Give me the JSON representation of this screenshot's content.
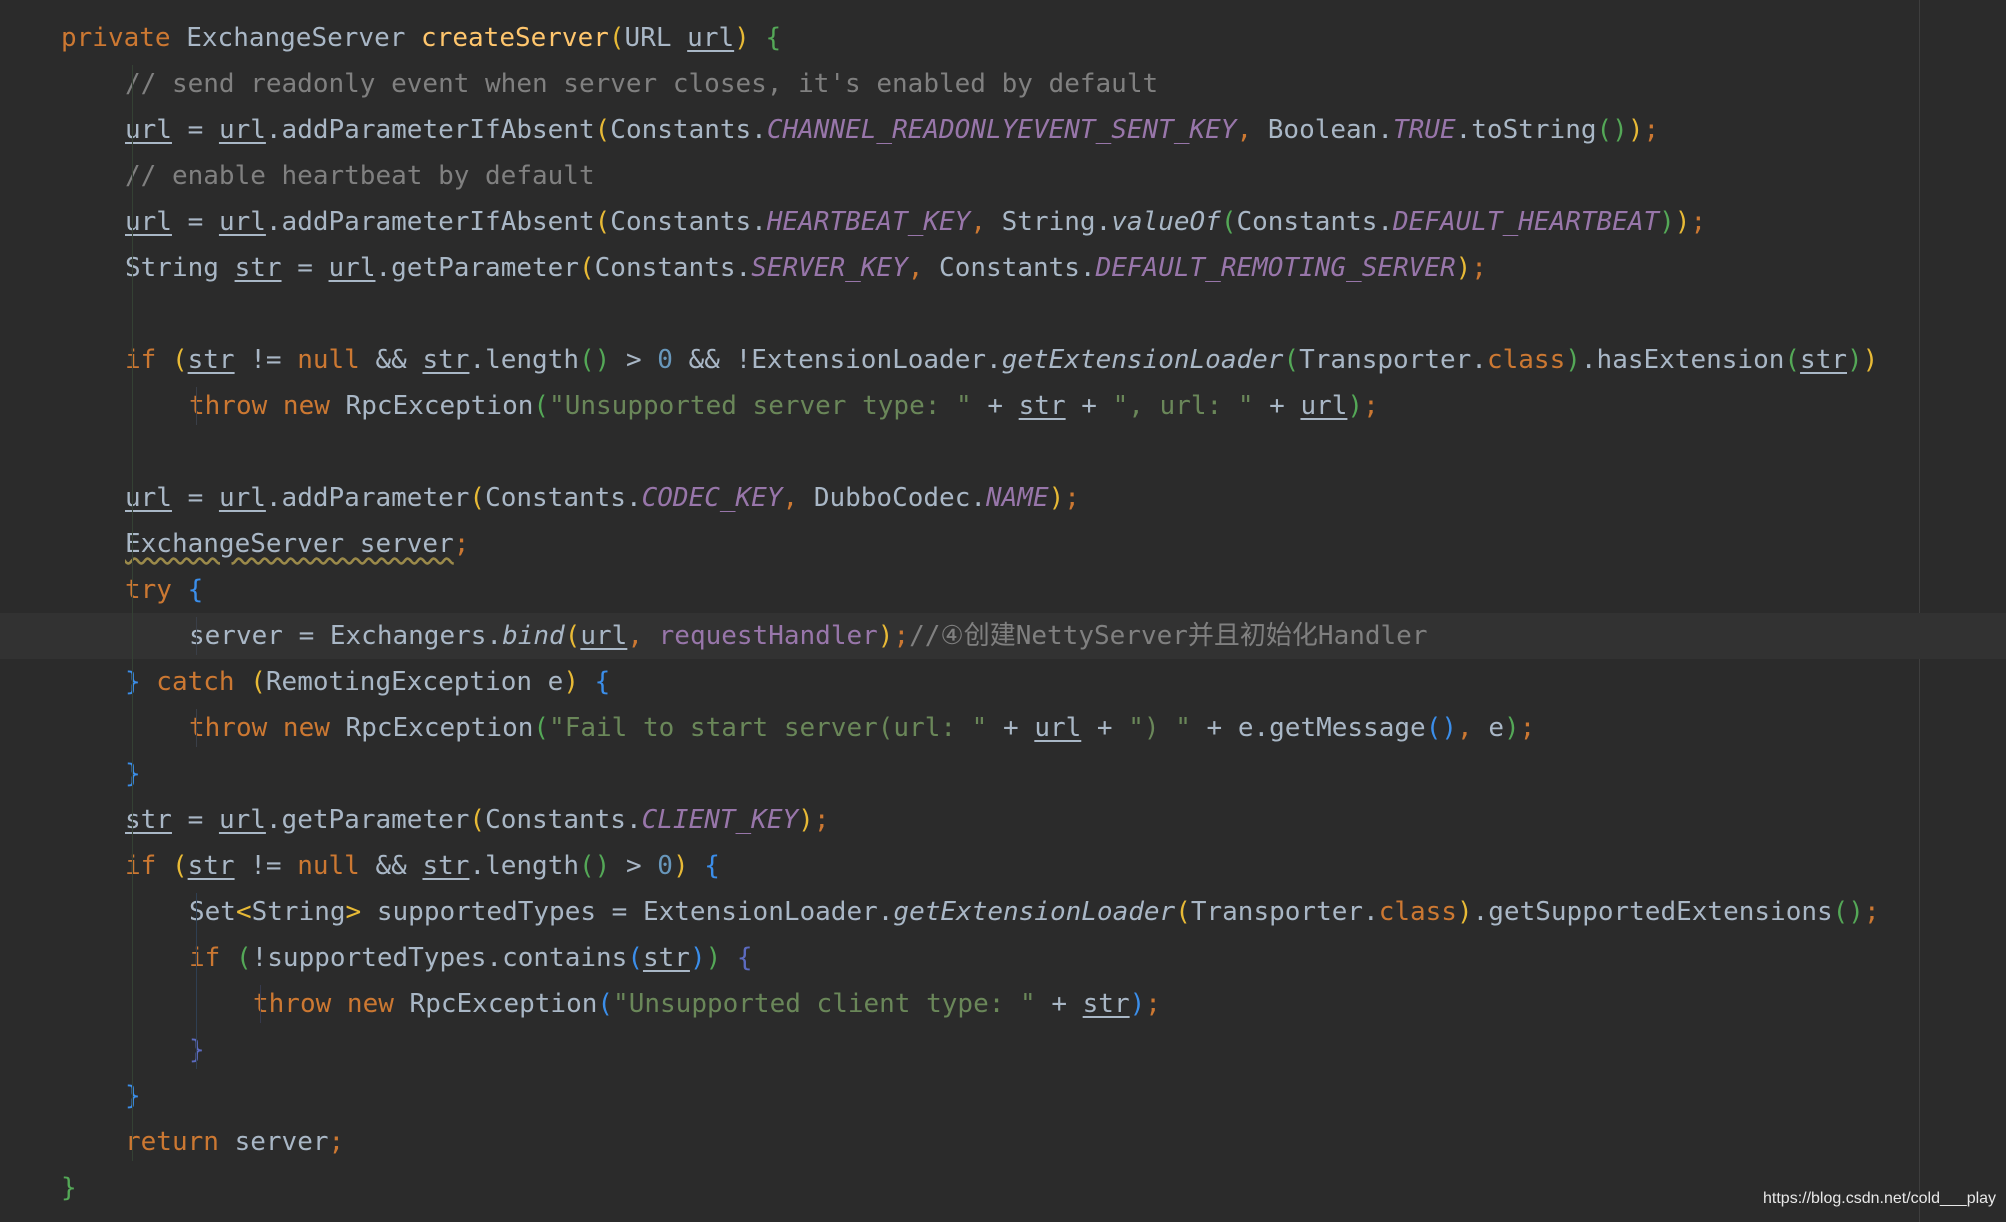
{
  "code": {
    "lines": [
      {
        "indent": 0,
        "tokens": [
          [
            "private ",
            "k"
          ],
          [
            "ExchangeServer ",
            "t"
          ],
          [
            "createServer",
            "m"
          ],
          [
            "(",
            "y"
          ],
          [
            "URL ",
            "t"
          ],
          [
            "url",
            "u"
          ],
          [
            ")",
            "y"
          ],
          [
            " ",
            "t"
          ],
          [
            "{",
            "g"
          ]
        ]
      },
      {
        "indent": 1,
        "tokens": [
          [
            "// send readonly event when server closes, it's enabled by default",
            "cm"
          ]
        ]
      },
      {
        "indent": 1,
        "tokens": [
          [
            "url",
            "u"
          ],
          [
            " = ",
            "t"
          ],
          [
            "url",
            "u"
          ],
          [
            ".addParameterIfAbsent",
            "t"
          ],
          [
            "(",
            "y"
          ],
          [
            "Constants.",
            "t"
          ],
          [
            "CHANNEL_READONLYEVENT_SENT_KEY",
            "c"
          ],
          [
            ", ",
            "k"
          ],
          [
            "Boolean.",
            "t"
          ],
          [
            "TRUE",
            "c"
          ],
          [
            ".toString",
            "t"
          ],
          [
            "()",
            "g"
          ],
          [
            ")",
            "y"
          ],
          [
            ";",
            "k"
          ]
        ]
      },
      {
        "indent": 1,
        "tokens": [
          [
            "// enable heartbeat by default",
            "cm"
          ]
        ]
      },
      {
        "indent": 1,
        "tokens": [
          [
            "url",
            "u"
          ],
          [
            " = ",
            "t"
          ],
          [
            "url",
            "u"
          ],
          [
            ".addParameterIfAbsent",
            "t"
          ],
          [
            "(",
            "y"
          ],
          [
            "Constants.",
            "t"
          ],
          [
            "HEARTBEAT_KEY",
            "c"
          ],
          [
            ", ",
            "k"
          ],
          [
            "String.",
            "t"
          ],
          [
            "valueOf",
            "i"
          ],
          [
            "(",
            "g"
          ],
          [
            "Constants.",
            "t"
          ],
          [
            "DEFAULT_HEARTBEAT",
            "c"
          ],
          [
            ")",
            "g"
          ],
          [
            ")",
            "y"
          ],
          [
            ";",
            "k"
          ]
        ]
      },
      {
        "indent": 1,
        "tokens": [
          [
            "String ",
            "t"
          ],
          [
            "str",
            "u"
          ],
          [
            " = ",
            "t"
          ],
          [
            "url",
            "u"
          ],
          [
            ".getParameter",
            "t"
          ],
          [
            "(",
            "y"
          ],
          [
            "Constants.",
            "t"
          ],
          [
            "SERVER_KEY",
            "c"
          ],
          [
            ", ",
            "k"
          ],
          [
            "Constants.",
            "t"
          ],
          [
            "DEFAULT_REMOTING_SERVER",
            "c"
          ],
          [
            ")",
            "y"
          ],
          [
            ";",
            "k"
          ]
        ]
      },
      {
        "indent": 0,
        "tokens": []
      },
      {
        "indent": 1,
        "tokens": [
          [
            "if ",
            "k"
          ],
          [
            "(",
            "y"
          ],
          [
            "str",
            "u"
          ],
          [
            " != ",
            "t"
          ],
          [
            "null",
            "k"
          ],
          [
            " && ",
            "t"
          ],
          [
            "str",
            "u"
          ],
          [
            ".length",
            "t"
          ],
          [
            "()",
            "g"
          ],
          [
            " > ",
            "t"
          ],
          [
            "0",
            "n"
          ],
          [
            " && !ExtensionLoader.",
            "t"
          ],
          [
            "getExtensionLoader",
            "i"
          ],
          [
            "(",
            "g"
          ],
          [
            "Transporter.",
            "t"
          ],
          [
            "class",
            "k"
          ],
          [
            ")",
            "g"
          ],
          [
            ".hasExtension",
            "t"
          ],
          [
            "(",
            "g"
          ],
          [
            "str",
            "u"
          ],
          [
            ")",
            "g"
          ],
          [
            ")",
            "y"
          ]
        ]
      },
      {
        "indent": 2,
        "tokens": [
          [
            "throw new ",
            "k"
          ],
          [
            "RpcException",
            "t"
          ],
          [
            "(",
            "g"
          ],
          [
            "\"Unsupported server type: \"",
            "s"
          ],
          [
            " + ",
            "t"
          ],
          [
            "str",
            "u"
          ],
          [
            " + ",
            "t"
          ],
          [
            "\", url: \"",
            "s"
          ],
          [
            " + ",
            "t"
          ],
          [
            "url",
            "u"
          ],
          [
            ")",
            "g"
          ],
          [
            ";",
            "k"
          ]
        ]
      },
      {
        "indent": 0,
        "tokens": []
      },
      {
        "indent": 1,
        "tokens": [
          [
            "url",
            "u"
          ],
          [
            " = ",
            "t"
          ],
          [
            "url",
            "u"
          ],
          [
            ".addParameter",
            "t"
          ],
          [
            "(",
            "y"
          ],
          [
            "Constants.",
            "t"
          ],
          [
            "CODEC_KEY",
            "c"
          ],
          [
            ", ",
            "k"
          ],
          [
            "DubboCodec.",
            "t"
          ],
          [
            "NAME",
            "c"
          ],
          [
            ")",
            "y"
          ],
          [
            ";",
            "k"
          ]
        ]
      },
      {
        "indent": 1,
        "tokens": [
          [
            "ExchangeServer server",
            "w"
          ],
          [
            ";",
            "k"
          ]
        ]
      },
      {
        "indent": 1,
        "tokens": [
          [
            "try ",
            "k"
          ],
          [
            "{",
            "b"
          ]
        ]
      },
      {
        "indent": 2,
        "highlight": true,
        "tokens": [
          [
            "server = Exchangers.",
            "t"
          ],
          [
            "bind",
            "i"
          ],
          [
            "(",
            "y"
          ],
          [
            "url",
            "u"
          ],
          [
            ", ",
            "k"
          ],
          [
            "requestHandler",
            "p"
          ],
          [
            ")",
            "y"
          ],
          [
            ";",
            "k"
          ],
          [
            "//④创建NettyServer并且初始化Handler",
            "cm"
          ]
        ]
      },
      {
        "indent": 1,
        "tokens": [
          [
            "}",
            "b"
          ],
          [
            " catch ",
            "k"
          ],
          [
            "(",
            "y"
          ],
          [
            "RemotingException e",
            "t"
          ],
          [
            ")",
            "y"
          ],
          [
            " ",
            "t"
          ],
          [
            "{",
            "b"
          ]
        ]
      },
      {
        "indent": 2,
        "tokens": [
          [
            "throw new ",
            "k"
          ],
          [
            "RpcException",
            "t"
          ],
          [
            "(",
            "g"
          ],
          [
            "\"Fail to start server(url: \"",
            "s"
          ],
          [
            " + ",
            "t"
          ],
          [
            "url",
            "u"
          ],
          [
            " + ",
            "t"
          ],
          [
            "\") \"",
            "s"
          ],
          [
            " + e.getMessage",
            "t"
          ],
          [
            "()",
            "b"
          ],
          [
            ", ",
            "k"
          ],
          [
            "e",
            "t"
          ],
          [
            ")",
            "g"
          ],
          [
            ";",
            "k"
          ]
        ]
      },
      {
        "indent": 1,
        "tokens": [
          [
            "}",
            "b"
          ]
        ]
      },
      {
        "indent": 1,
        "tokens": [
          [
            "str",
            "u"
          ],
          [
            " = ",
            "t"
          ],
          [
            "url",
            "u"
          ],
          [
            ".getParameter",
            "t"
          ],
          [
            "(",
            "y"
          ],
          [
            "Constants.",
            "t"
          ],
          [
            "CLIENT_KEY",
            "c"
          ],
          [
            ")",
            "y"
          ],
          [
            ";",
            "k"
          ]
        ]
      },
      {
        "indent": 1,
        "tokens": [
          [
            "if ",
            "k"
          ],
          [
            "(",
            "y"
          ],
          [
            "str",
            "u"
          ],
          [
            " != ",
            "t"
          ],
          [
            "null",
            "k"
          ],
          [
            " && ",
            "t"
          ],
          [
            "str",
            "u"
          ],
          [
            ".length",
            "t"
          ],
          [
            "()",
            "g"
          ],
          [
            " > ",
            "t"
          ],
          [
            "0",
            "n"
          ],
          [
            ")",
            "y"
          ],
          [
            " ",
            "t"
          ],
          [
            "{",
            "b"
          ]
        ]
      },
      {
        "indent": 2,
        "tokens": [
          [
            "Set",
            "t"
          ],
          [
            "<",
            "y"
          ],
          [
            "String",
            "t"
          ],
          [
            ">",
            "y"
          ],
          [
            " supportedTypes = ExtensionLoader.",
            "t"
          ],
          [
            "getExtensionLoader",
            "i"
          ],
          [
            "(",
            "y"
          ],
          [
            "Transporter.",
            "t"
          ],
          [
            "class",
            "k"
          ],
          [
            ")",
            "y"
          ],
          [
            ".getSupportedExtensions",
            "t"
          ],
          [
            "()",
            "g"
          ],
          [
            ";",
            "k"
          ]
        ]
      },
      {
        "indent": 2,
        "tokens": [
          [
            "if ",
            "k"
          ],
          [
            "(",
            "g"
          ],
          [
            "!supportedTypes.contains",
            "t"
          ],
          [
            "(",
            "b"
          ],
          [
            "str",
            "u"
          ],
          [
            ")",
            "b"
          ],
          [
            ")",
            "g"
          ],
          [
            " ",
            "t"
          ],
          [
            "{",
            "v"
          ]
        ]
      },
      {
        "indent": 3,
        "tokens": [
          [
            "throw new ",
            "k"
          ],
          [
            "RpcException",
            "t"
          ],
          [
            "(",
            "b"
          ],
          [
            "\"Unsupported client type: \"",
            "s"
          ],
          [
            " + ",
            "t"
          ],
          [
            "str",
            "u"
          ],
          [
            ")",
            "b"
          ],
          [
            ";",
            "k"
          ]
        ]
      },
      {
        "indent": 2,
        "tokens": [
          [
            "}",
            "v"
          ]
        ]
      },
      {
        "indent": 1,
        "tokens": [
          [
            "}",
            "b"
          ]
        ]
      },
      {
        "indent": 1,
        "tokens": [
          [
            "return ",
            "k"
          ],
          [
            "server",
            "t"
          ],
          [
            ";",
            "k"
          ]
        ]
      },
      {
        "indent": 0,
        "tokens": [
          [
            "}",
            "g"
          ]
        ]
      }
    ]
  },
  "watermark": "https://blog.csdn.net/cold___play"
}
